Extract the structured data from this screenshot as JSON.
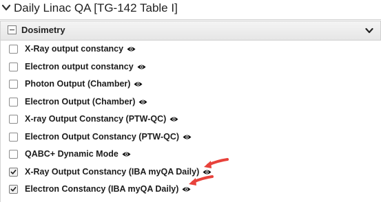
{
  "header": {
    "title": "Daily Linac QA [TG-142 Table I]"
  },
  "section": {
    "title": "Dosimetry",
    "expanded": true
  },
  "items": [
    {
      "label": "X-Ray output constancy",
      "checked": false,
      "icon": "eye-icon"
    },
    {
      "label": "Electron output constancy",
      "checked": false,
      "icon": "eye-icon"
    },
    {
      "label": "Photon Output (Chamber)",
      "checked": false,
      "icon": "eye-icon"
    },
    {
      "label": "Electron Output (Chamber)",
      "checked": false,
      "icon": "eye-icon"
    },
    {
      "label": "X-ray Output Constancy (PTW-QC)",
      "checked": false,
      "icon": "eye-icon"
    },
    {
      "label": "Electron Output Constancy (PTW-QC)",
      "checked": false,
      "icon": "eye-icon"
    },
    {
      "label": "QABC+ Dynamic Mode",
      "checked": false,
      "icon": "eye-icon"
    },
    {
      "label": "X-Ray Output Constancy (IBA myQA Daily)",
      "checked": true,
      "icon": "eye-icon"
    },
    {
      "label": "Electron Constancy (IBA myQA Daily)",
      "checked": true,
      "icon": "eye-icon"
    }
  ],
  "colors": {
    "annotation_arrow": "#e8423b",
    "header_bg": "#ebebeb"
  }
}
